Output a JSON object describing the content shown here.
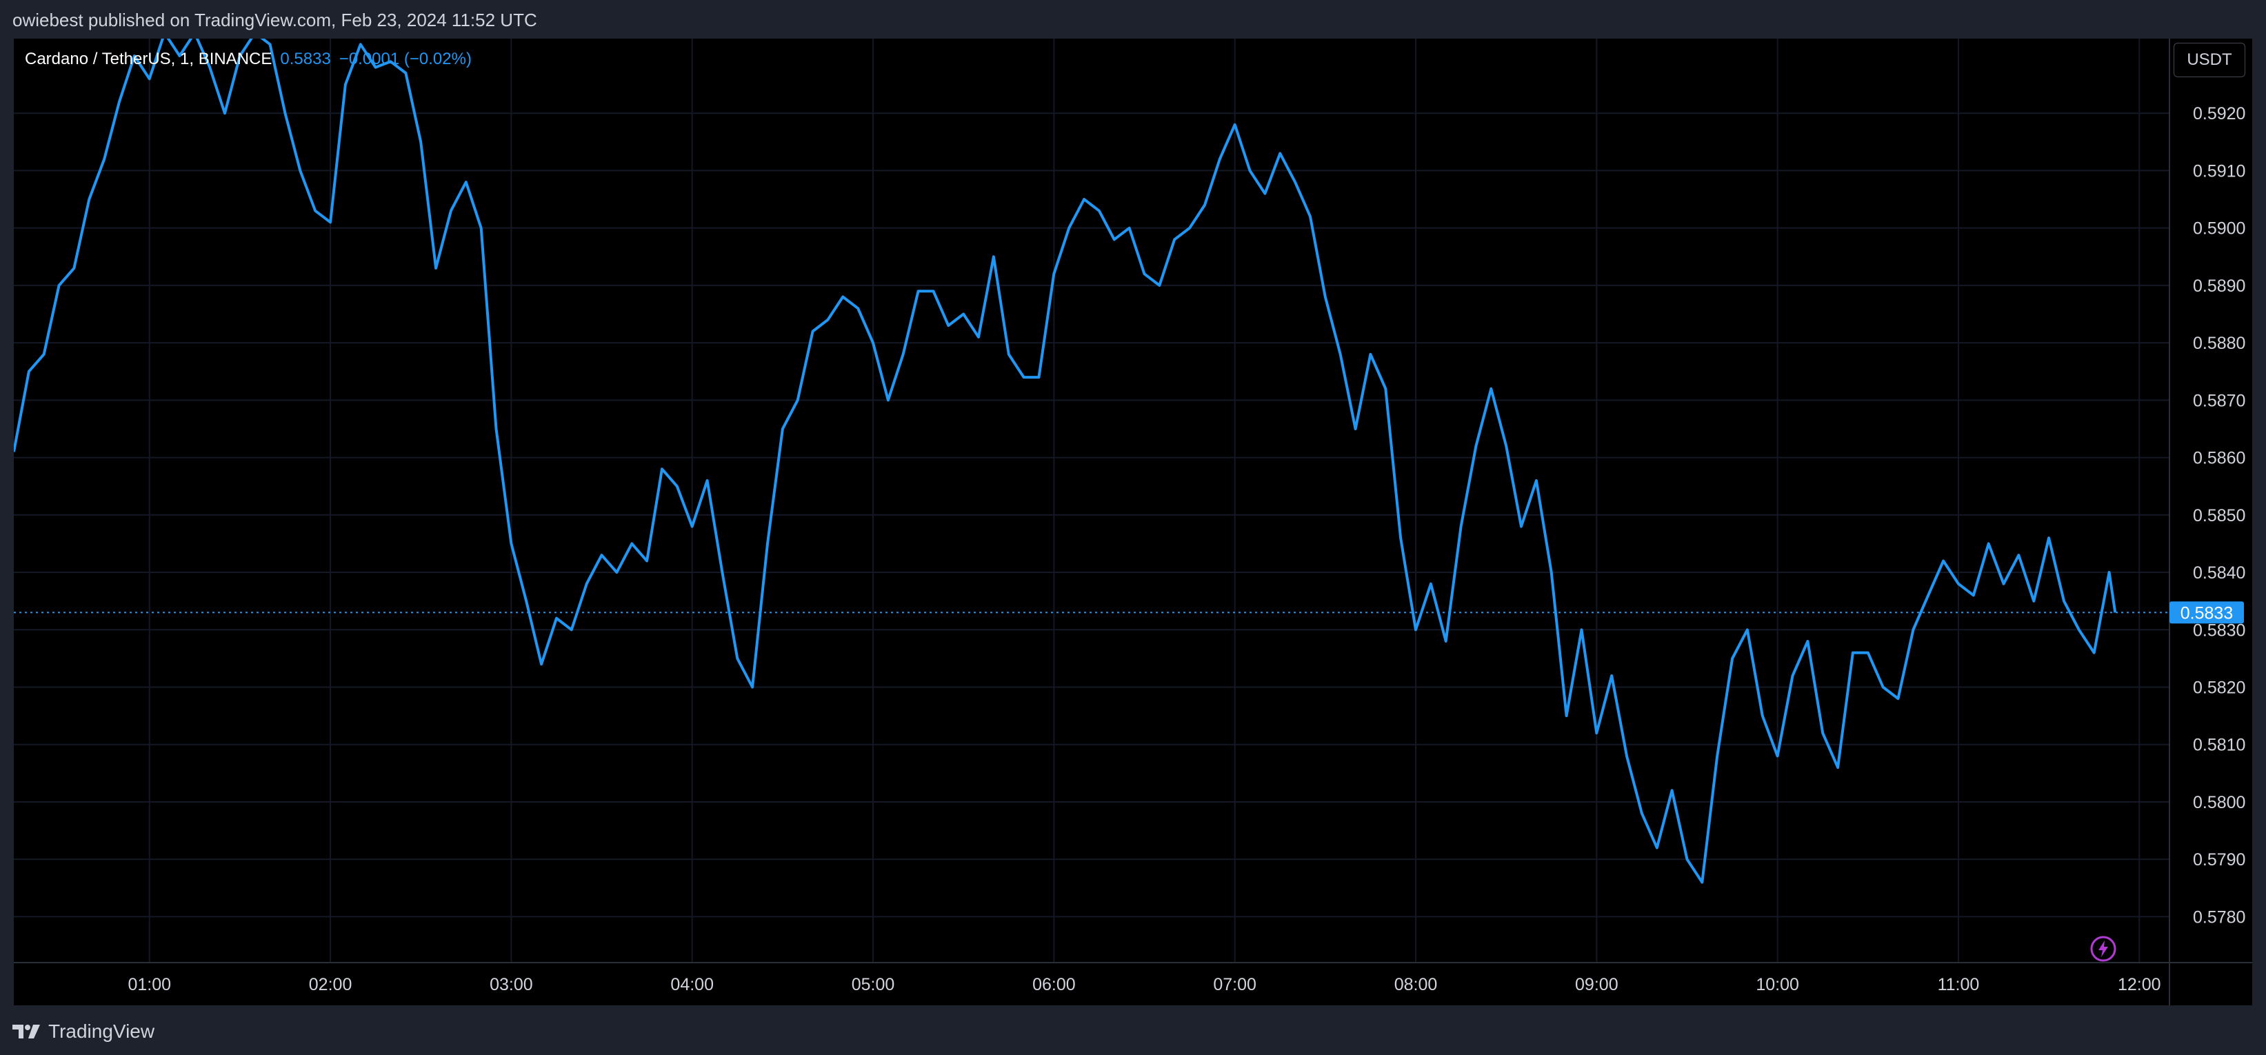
{
  "header": {
    "published_text": "owiebest published on TradingView.com, Feb 23, 2024 11:52 UTC"
  },
  "legend": {
    "symbol": "Cardano / TetherUS, 1, BINANCE",
    "last_value": "0.5833",
    "change": "−0.0001 (−0.02%)"
  },
  "currency_button": "USDT",
  "footer": {
    "brand": "TradingView"
  },
  "icons": {
    "lightning": "lightning-icon",
    "logo": "tradingview-logo-icon"
  },
  "colors": {
    "line": "#2196f3",
    "background": "#000000",
    "price_label": "#2196f3",
    "grid": "#141824",
    "bolt": "#b43ad6"
  },
  "chart_data": {
    "type": "line",
    "title": "Cardano / TetherUS, 1, BINANCE",
    "xlabel": "",
    "ylabel": "",
    "x_ticks": [
      "01:00",
      "02:00",
      "03:00",
      "04:00",
      "05:00",
      "06:00",
      "07:00",
      "08:00",
      "09:00",
      "10:00",
      "11:00",
      "12:00"
    ],
    "y_ticks": [
      "0.5780",
      "0.5790",
      "0.5800",
      "0.5810",
      "0.5820",
      "0.5830",
      "0.5840",
      "0.5850",
      "0.5860",
      "0.5870",
      "0.5880",
      "0.5890",
      "0.5900",
      "0.5910",
      "0.5920"
    ],
    "ylim": [
      0.5772,
      0.5933
    ],
    "xlim": [
      "00:15",
      "12:10"
    ],
    "grid": true,
    "current_price": 0.5833,
    "current_price_label": "0.5833",
    "series": [
      {
        "values": [
          {
            "x": "00:15",
            "y": 0.5861
          },
          {
            "x": "00:20",
            "y": 0.5875
          },
          {
            "x": "00:25",
            "y": 0.5878
          },
          {
            "x": "00:30",
            "y": 0.589
          },
          {
            "x": "00:35",
            "y": 0.5893
          },
          {
            "x": "00:40",
            "y": 0.5905
          },
          {
            "x": "00:45",
            "y": 0.5912
          },
          {
            "x": "00:50",
            "y": 0.5922
          },
          {
            "x": "00:55",
            "y": 0.593
          },
          {
            "x": "01:00",
            "y": 0.5926
          },
          {
            "x": "01:05",
            "y": 0.5934
          },
          {
            "x": "01:10",
            "y": 0.593
          },
          {
            "x": "01:15",
            "y": 0.5934
          },
          {
            "x": "01:20",
            "y": 0.5928
          },
          {
            "x": "01:25",
            "y": 0.592
          },
          {
            "x": "01:30",
            "y": 0.593
          },
          {
            "x": "01:35",
            "y": 0.5934
          },
          {
            "x": "01:40",
            "y": 0.5932
          },
          {
            "x": "01:45",
            "y": 0.592
          },
          {
            "x": "01:50",
            "y": 0.591
          },
          {
            "x": "01:55",
            "y": 0.5903
          },
          {
            "x": "02:00",
            "y": 0.5901
          },
          {
            "x": "02:05",
            "y": 0.5925
          },
          {
            "x": "02:10",
            "y": 0.5932
          },
          {
            "x": "02:15",
            "y": 0.5928
          },
          {
            "x": "02:20",
            "y": 0.5929
          },
          {
            "x": "02:25",
            "y": 0.5927
          },
          {
            "x": "02:30",
            "y": 0.5915
          },
          {
            "x": "02:35",
            "y": 0.5893
          },
          {
            "x": "02:40",
            "y": 0.5903
          },
          {
            "x": "02:45",
            "y": 0.5908
          },
          {
            "x": "02:50",
            "y": 0.59
          },
          {
            "x": "02:55",
            "y": 0.5865
          },
          {
            "x": "03:00",
            "y": 0.5845
          },
          {
            "x": "03:05",
            "y": 0.5835
          },
          {
            "x": "03:10",
            "y": 0.5824
          },
          {
            "x": "03:15",
            "y": 0.5832
          },
          {
            "x": "03:20",
            "y": 0.583
          },
          {
            "x": "03:25",
            "y": 0.5838
          },
          {
            "x": "03:30",
            "y": 0.5843
          },
          {
            "x": "03:35",
            "y": 0.584
          },
          {
            "x": "03:40",
            "y": 0.5845
          },
          {
            "x": "03:45",
            "y": 0.5842
          },
          {
            "x": "03:50",
            "y": 0.5858
          },
          {
            "x": "03:55",
            "y": 0.5855
          },
          {
            "x": "04:00",
            "y": 0.5848
          },
          {
            "x": "04:05",
            "y": 0.5856
          },
          {
            "x": "04:10",
            "y": 0.584
          },
          {
            "x": "04:15",
            "y": 0.5825
          },
          {
            "x": "04:20",
            "y": 0.582
          },
          {
            "x": "04:25",
            "y": 0.5845
          },
          {
            "x": "04:30",
            "y": 0.5865
          },
          {
            "x": "04:35",
            "y": 0.587
          },
          {
            "x": "04:40",
            "y": 0.5882
          },
          {
            "x": "04:45",
            "y": 0.5884
          },
          {
            "x": "04:50",
            "y": 0.5888
          },
          {
            "x": "04:55",
            "y": 0.5886
          },
          {
            "x": "05:00",
            "y": 0.588
          },
          {
            "x": "05:05",
            "y": 0.587
          },
          {
            "x": "05:10",
            "y": 0.5878
          },
          {
            "x": "05:15",
            "y": 0.5889
          },
          {
            "x": "05:20",
            "y": 0.5889
          },
          {
            "x": "05:25",
            "y": 0.5883
          },
          {
            "x": "05:30",
            "y": 0.5885
          },
          {
            "x": "05:35",
            "y": 0.5881
          },
          {
            "x": "05:40",
            "y": 0.5895
          },
          {
            "x": "05:45",
            "y": 0.5878
          },
          {
            "x": "05:50",
            "y": 0.5874
          },
          {
            "x": "05:55",
            "y": 0.5874
          },
          {
            "x": "06:00",
            "y": 0.5892
          },
          {
            "x": "06:05",
            "y": 0.59
          },
          {
            "x": "06:10",
            "y": 0.5905
          },
          {
            "x": "06:15",
            "y": 0.5903
          },
          {
            "x": "06:20",
            "y": 0.5898
          },
          {
            "x": "06:25",
            "y": 0.59
          },
          {
            "x": "06:30",
            "y": 0.5892
          },
          {
            "x": "06:35",
            "y": 0.589
          },
          {
            "x": "06:40",
            "y": 0.5898
          },
          {
            "x": "06:45",
            "y": 0.59
          },
          {
            "x": "06:50",
            "y": 0.5904
          },
          {
            "x": "06:55",
            "y": 0.5912
          },
          {
            "x": "07:00",
            "y": 0.5918
          },
          {
            "x": "07:05",
            "y": 0.591
          },
          {
            "x": "07:10",
            "y": 0.5906
          },
          {
            "x": "07:15",
            "y": 0.5913
          },
          {
            "x": "07:20",
            "y": 0.5908
          },
          {
            "x": "07:25",
            "y": 0.5902
          },
          {
            "x": "07:30",
            "y": 0.5888
          },
          {
            "x": "07:35",
            "y": 0.5878
          },
          {
            "x": "07:40",
            "y": 0.5865
          },
          {
            "x": "07:45",
            "y": 0.5878
          },
          {
            "x": "07:50",
            "y": 0.5872
          },
          {
            "x": "07:55",
            "y": 0.5846
          },
          {
            "x": "08:00",
            "y": 0.583
          },
          {
            "x": "08:05",
            "y": 0.5838
          },
          {
            "x": "08:10",
            "y": 0.5828
          },
          {
            "x": "08:15",
            "y": 0.5848
          },
          {
            "x": "08:20",
            "y": 0.5862
          },
          {
            "x": "08:25",
            "y": 0.5872
          },
          {
            "x": "08:30",
            "y": 0.5862
          },
          {
            "x": "08:35",
            "y": 0.5848
          },
          {
            "x": "08:40",
            "y": 0.5856
          },
          {
            "x": "08:45",
            "y": 0.584
          },
          {
            "x": "08:50",
            "y": 0.5815
          },
          {
            "x": "08:55",
            "y": 0.583
          },
          {
            "x": "09:00",
            "y": 0.5812
          },
          {
            "x": "09:05",
            "y": 0.5822
          },
          {
            "x": "09:10",
            "y": 0.5808
          },
          {
            "x": "09:15",
            "y": 0.5798
          },
          {
            "x": "09:20",
            "y": 0.5792
          },
          {
            "x": "09:25",
            "y": 0.5802
          },
          {
            "x": "09:30",
            "y": 0.579
          },
          {
            "x": "09:35",
            "y": 0.5786
          },
          {
            "x": "09:40",
            "y": 0.5808
          },
          {
            "x": "09:45",
            "y": 0.5825
          },
          {
            "x": "09:50",
            "y": 0.583
          },
          {
            "x": "09:55",
            "y": 0.5815
          },
          {
            "x": "10:00",
            "y": 0.5808
          },
          {
            "x": "10:05",
            "y": 0.5822
          },
          {
            "x": "10:10",
            "y": 0.5828
          },
          {
            "x": "10:15",
            "y": 0.5812
          },
          {
            "x": "10:20",
            "y": 0.5806
          },
          {
            "x": "10:25",
            "y": 0.5826
          },
          {
            "x": "10:30",
            "y": 0.5826
          },
          {
            "x": "10:35",
            "y": 0.582
          },
          {
            "x": "10:40",
            "y": 0.5818
          },
          {
            "x": "10:45",
            "y": 0.583
          },
          {
            "x": "10:50",
            "y": 0.5836
          },
          {
            "x": "10:55",
            "y": 0.5842
          },
          {
            "x": "11:00",
            "y": 0.5838
          },
          {
            "x": "11:05",
            "y": 0.5836
          },
          {
            "x": "11:10",
            "y": 0.5845
          },
          {
            "x": "11:15",
            "y": 0.5838
          },
          {
            "x": "11:20",
            "y": 0.5843
          },
          {
            "x": "11:25",
            "y": 0.5835
          },
          {
            "x": "11:30",
            "y": 0.5846
          },
          {
            "x": "11:35",
            "y": 0.5835
          },
          {
            "x": "11:40",
            "y": 0.583
          },
          {
            "x": "11:45",
            "y": 0.5826
          },
          {
            "x": "11:50",
            "y": 0.584
          },
          {
            "x": "11:52",
            "y": 0.5833
          }
        ]
      }
    ]
  }
}
